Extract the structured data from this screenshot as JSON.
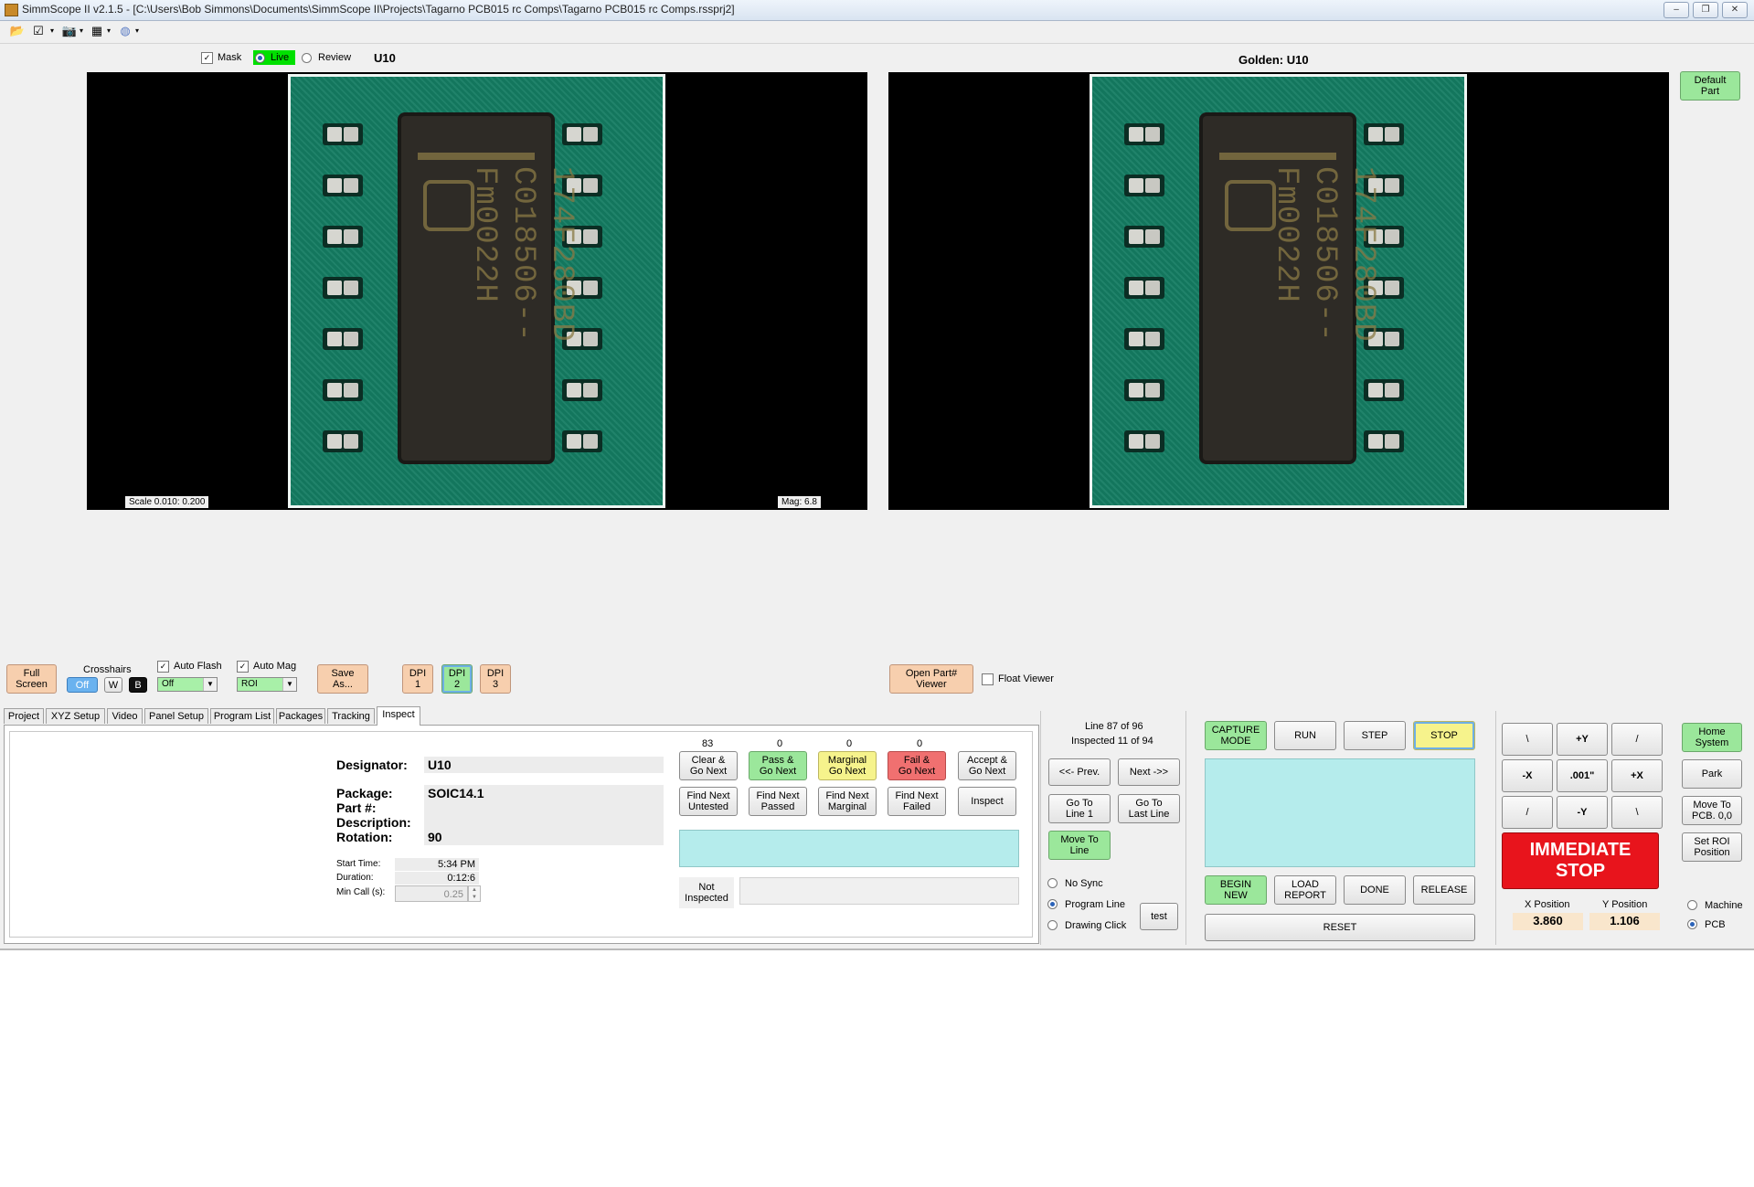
{
  "window": {
    "title": "SimmScope II  v2.1.5 - [C:\\Users\\Bob Simmons\\Documents\\SimmScope II\\Projects\\Tagarno PCB015 rc Comps\\Tagarno PCB015 rc Comps.rssprj2]",
    "controls": [
      "–",
      "❐",
      "✕"
    ]
  },
  "toolbar": {
    "icons": [
      "open-folder-icon",
      "checklist-icon",
      "camera-icon",
      "grid-icon",
      "globe-icon"
    ]
  },
  "live_view": {
    "mask_label": "Mask",
    "mask_checked": true,
    "live_label": "Live",
    "live_selected": true,
    "review_label": "Review",
    "designator": "U10",
    "scale_text": "Scale 0.010:  0.200",
    "mag_text": "Mag: 6.8",
    "chip_marking": "174F280BD\nC018506--\nFm0022H"
  },
  "golden_view": {
    "label": "Golden:  U10",
    "default_part_button": "Default\nPart",
    "chip_marking": "174F280BD\nC018506--\nFm0022H"
  },
  "controls_row": {
    "full_screen": "Full\nScreen",
    "crosshairs_label": "Crosshairs",
    "crosshairs_off": "Off",
    "crosshairs_w": "W",
    "crosshairs_b": "B",
    "auto_flash_label": "Auto Flash",
    "auto_flash_checked": true,
    "auto_flash_value": "Off",
    "auto_mag_label": "Auto Mag",
    "auto_mag_checked": true,
    "auto_mag_value": "ROI",
    "save_as": "Save\nAs...",
    "dpi1": "DPI\n1",
    "dpi2": "DPI\n2",
    "dpi3": "DPI\n3",
    "open_part_viewer": "Open Part#\nViewer",
    "float_viewer_label": "Float Viewer",
    "float_viewer_checked": false
  },
  "tabs": [
    "Project",
    "XYZ Setup",
    "Video",
    "Panel Setup",
    "Program List",
    "Packages",
    "Tracking",
    "Inspect"
  ],
  "active_tab": "Inspect",
  "inspect": {
    "designator_label": "Designator:",
    "designator_value": "U10",
    "package_label": "Package:",
    "package_value": "SOIC14.1",
    "part_label": "Part #:",
    "part_value": "",
    "description_label": "Description:",
    "description_value": "",
    "rotation_label": "Rotation:",
    "rotation_value": "90",
    "start_time_label": "Start Time:",
    "start_time_value": "5:34 PM",
    "duration_label": "Duration:",
    "duration_value": "0:12:6",
    "min_call_label": "Min Call (s):",
    "min_call_value": "0.25",
    "counts": [
      "83",
      "0",
      "0",
      "0"
    ],
    "clear_go_next": "Clear &\nGo Next",
    "pass_go_next": "Pass &\nGo Next",
    "marginal_go_next": "Marginal\nGo Next",
    "fail_go_next": "Fail &\nGo Next",
    "accept_go_next": "Accept &\nGo Next",
    "find_next_untested": "Find Next\nUntested",
    "find_next_passed": "Find Next\nPassed",
    "find_next_marginal": "Find Next\nMarginal",
    "find_next_failed": "Find Next\nFailed",
    "inspect_button": "Inspect",
    "not_inspected": "Not\nInspected"
  },
  "navigation": {
    "line_status": "Line 87 of 96",
    "inspected_status": "Inspected 11 of 94",
    "prev": "<<- Prev.",
    "next": "Next ->>",
    "go_to_line1": "Go To\nLine 1",
    "go_to_last_line": "Go To\nLast Line",
    "move_to_line": "Move To\nLine",
    "no_sync": "No Sync",
    "program_line": "Program Line",
    "drawing_click": "Drawing Click",
    "sync_selected": "Program Line",
    "test": "test"
  },
  "run_panel": {
    "capture_mode": "CAPTURE\nMODE",
    "run": "RUN",
    "step": "STEP",
    "stop": "STOP",
    "begin_new": "BEGIN\nNEW",
    "load_report": "LOAD\nREPORT",
    "done": "DONE",
    "release": "RELEASE",
    "reset": "RESET"
  },
  "motion": {
    "up_left": "\\",
    "plus_y": "+Y",
    "up_right": "/",
    "minus_x": "-X",
    "step": ".001\"",
    "plus_x": "+X",
    "down_left": "/",
    "minus_y": "-Y",
    "down_right": "\\",
    "immediate_stop": "IMMEDIATE\nSTOP",
    "x_position_label": "X Position",
    "x_position_value": "3.860",
    "y_position_label": "Y Position",
    "y_position_value": "1.106",
    "home_system": "Home\nSystem",
    "park": "Park",
    "move_to_pcb": "Move To\nPCB. 0,0",
    "set_roi_position": "Set ROI\nPosition",
    "machine_label": "Machine",
    "pcb_label": "PCB",
    "coord_selected": "PCB"
  },
  "colors": {
    "board_green": "#147c62",
    "live_green": "#00e000",
    "status_cyan": "#b5ecec",
    "stop_red": "#e8141c"
  }
}
